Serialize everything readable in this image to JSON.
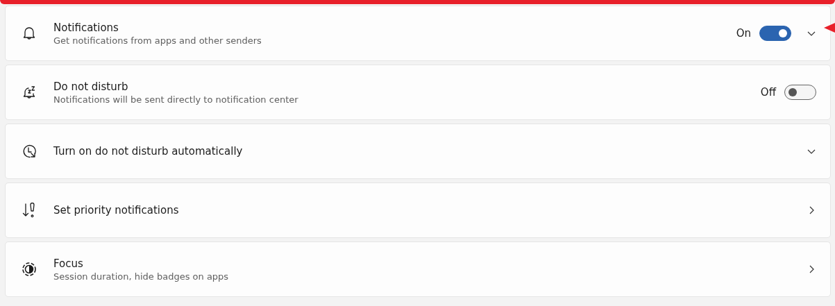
{
  "settings": [
    {
      "kind": "toggle-expand",
      "title": "Notifications",
      "subtitle": "Get notifications from apps and other senders",
      "state_label": "On",
      "on": true
    },
    {
      "kind": "toggle",
      "title": "Do not disturb",
      "subtitle": "Notifications will be sent directly to notification center",
      "state_label": "Off",
      "on": false
    },
    {
      "kind": "expand",
      "title": "Turn on do not disturb automatically"
    },
    {
      "kind": "link",
      "title": "Set priority notifications"
    },
    {
      "kind": "link",
      "title": "Focus",
      "subtitle": "Session duration, hide badges on apps"
    }
  ]
}
